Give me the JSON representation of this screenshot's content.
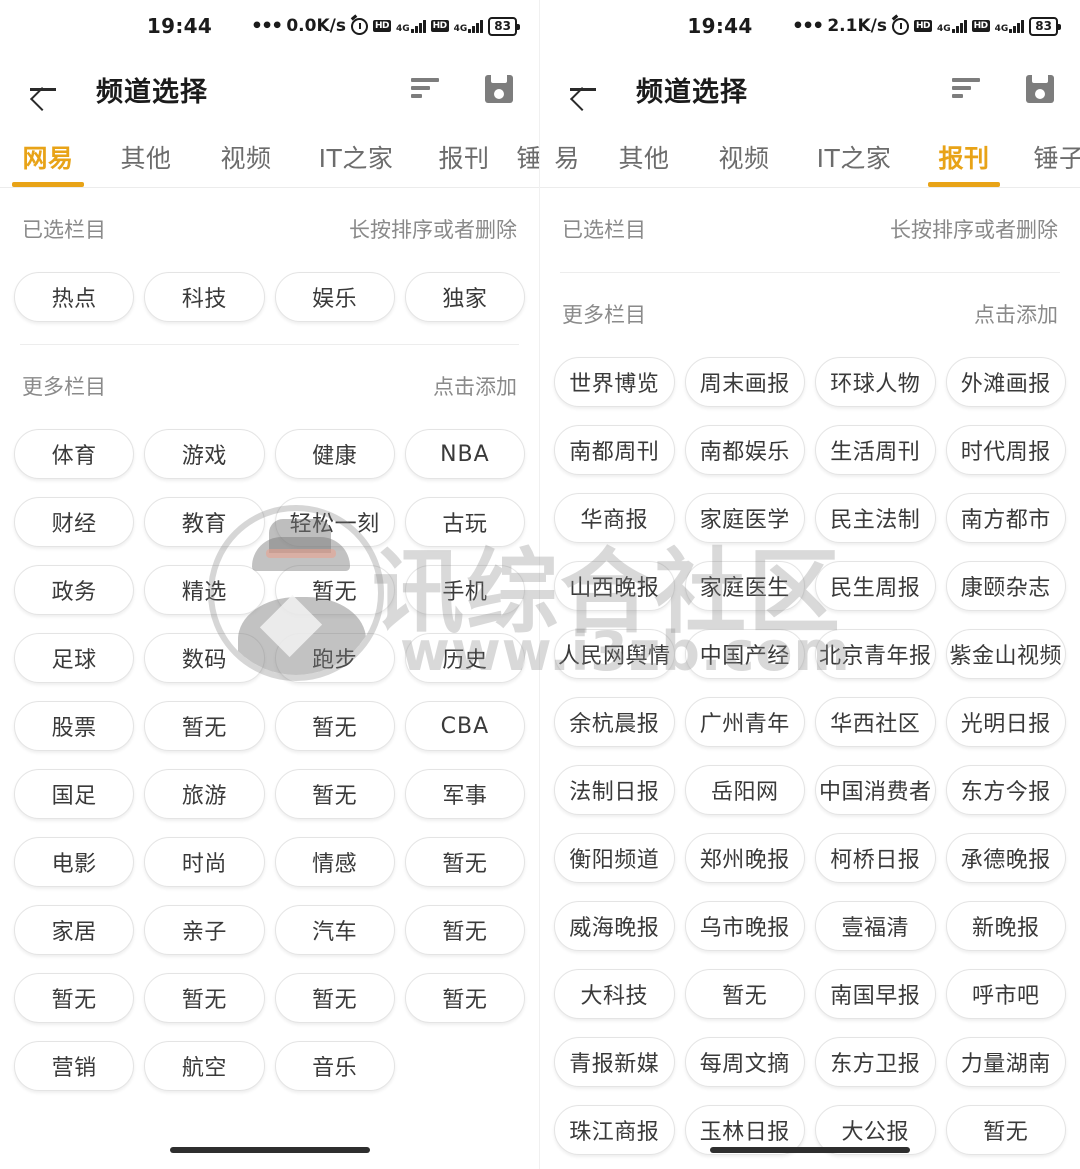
{
  "panels": [
    {
      "statusbar": {
        "time": "19:44",
        "dots": "•••",
        "speed": "0.0K/s",
        "alarm_icon": "alarm-icon",
        "hd_label": "HD",
        "network_label": "4G",
        "battery": "83"
      },
      "appbar": {
        "back_icon": "back-arrow-icon",
        "title": "频道选择",
        "sort_icon": "sort-icon",
        "save_icon": "save-icon"
      },
      "tabs": [
        {
          "label": "网易",
          "active": true
        },
        {
          "label": "其他",
          "active": false
        },
        {
          "label": "视频",
          "active": false
        },
        {
          "label": "IT之家",
          "active": false
        },
        {
          "label": "报刊",
          "active": false
        },
        {
          "label": "锤子",
          "active": false
        }
      ],
      "selected_section": {
        "title": "已选栏目",
        "hint": "长按排序或者删除",
        "chips": [
          "热点",
          "科技",
          "娱乐",
          "独家"
        ]
      },
      "more_section": {
        "title": "更多栏目",
        "hint": "点击添加",
        "chips": [
          "体育",
          "游戏",
          "健康",
          "NBA",
          "财经",
          "教育",
          "轻松一刻",
          "古玩",
          "政务",
          "精选",
          "暂无",
          "手机",
          "足球",
          "数码",
          "跑步",
          "历史",
          "股票",
          "暂无",
          "暂无",
          "CBA",
          "国足",
          "旅游",
          "暂无",
          "军事",
          "电影",
          "时尚",
          "情感",
          "暂无",
          "家居",
          "亲子",
          "汽车",
          "暂无",
          "暂无",
          "暂无",
          "暂无",
          "暂无",
          "营销",
          "航空",
          "音乐"
        ]
      }
    },
    {
      "statusbar": {
        "time": "19:44",
        "dots": "•••",
        "speed": "2.1K/s",
        "alarm_icon": "alarm-icon",
        "hd_label": "HD",
        "network_label": "4G",
        "battery": "83"
      },
      "appbar": {
        "back_icon": "back-arrow-icon",
        "title": "频道选择",
        "sort_icon": "sort-icon",
        "save_icon": "save-icon"
      },
      "tabs": [
        {
          "label": "易",
          "active": false
        },
        {
          "label": "其他",
          "active": false
        },
        {
          "label": "视频",
          "active": false
        },
        {
          "label": "IT之家",
          "active": false
        },
        {
          "label": "报刊",
          "active": true
        },
        {
          "label": "锤子",
          "active": false
        }
      ],
      "selected_section": {
        "title": "已选栏目",
        "hint": "长按排序或者删除",
        "chips": []
      },
      "more_section": {
        "title": "更多栏目",
        "hint": "点击添加",
        "chips": [
          "世界博览",
          "周末画报",
          "环球人物",
          "外滩画报",
          "南都周刊",
          "南都娱乐",
          "生活周刊",
          "时代周报",
          "华商报",
          "家庭医学",
          "民主法制",
          "南方都市",
          "山西晚报",
          "家庭医生",
          "民生周报",
          "康颐杂志",
          "人民网舆情",
          "中国产经",
          "北京青年报",
          "紫金山视频",
          "余杭晨报",
          "广州青年",
          "华西社区",
          "光明日报",
          "法制日报",
          "岳阳网",
          "中国消费者",
          "东方今报",
          "衡阳频道",
          "郑州晚报",
          "柯桥日报",
          "承德晚报",
          "威海晚报",
          "乌市晚报",
          "壹福清",
          "新晚报",
          "大科技",
          "暂无",
          "南国早报",
          "呼市吧",
          "青报新媒",
          "每周文摘",
          "东方卫报",
          "力量湖南",
          "珠江商报",
          "玉林日报",
          "大公报",
          "暂无"
        ]
      }
    }
  ],
  "watermark": {
    "avatar_icon": "detective-avatar-icon",
    "text": "讯综合社区",
    "url": "www.i3zb.com"
  },
  "colors": {
    "accent": "#e8a317",
    "text_primary": "#1b1b1b",
    "text_secondary": "#8a8a8a",
    "chip_text": "#3a3a3a",
    "chip_border": "#e4e4e4",
    "background": "#ffffff"
  }
}
